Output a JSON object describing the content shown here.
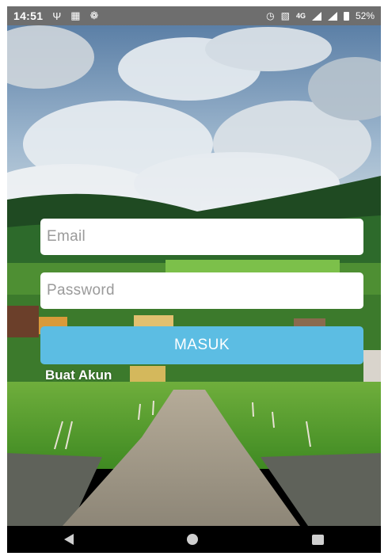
{
  "status_bar": {
    "time": "14:51",
    "network": "4G",
    "battery": "52%",
    "icons": [
      "usb-icon",
      "image-icon",
      "sync-icon",
      "alarm-icon",
      "vibrate-icon",
      "signal-icon",
      "battery-icon"
    ]
  },
  "login": {
    "email_placeholder": "Email",
    "password_placeholder": "Password",
    "submit_label": "MASUK",
    "create_account_label": "Buat Akun"
  },
  "colors": {
    "button": "#5cbde3",
    "input_bg": "#ffffff",
    "status_bar": "#6e6e6e",
    "nav_bar": "#000000"
  },
  "nav_bar": {
    "icons": [
      "back-icon",
      "home-icon",
      "recents-icon"
    ]
  }
}
